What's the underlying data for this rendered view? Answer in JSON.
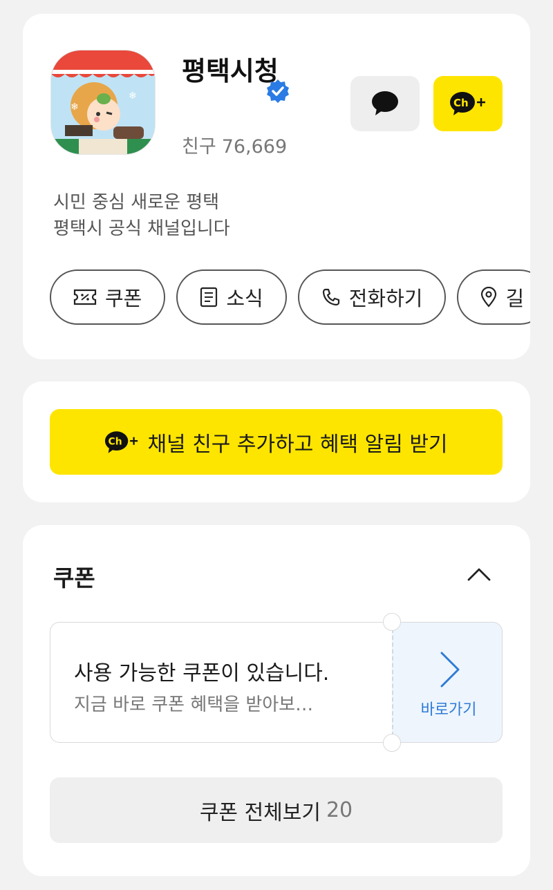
{
  "profile": {
    "name": "평택시청",
    "friends_label": "친구",
    "friends_count": "76,669",
    "description_line1": "시민 중심 새로운 평택",
    "description_line2": "평택시 공식 채널입니다",
    "verified_icon": "verified-check-icon",
    "chat_icon": "chat-bubble-icon",
    "channel_add_icon": "channel-plus-icon",
    "chips": [
      {
        "label": "쿠폰",
        "icon": "coupon-icon"
      },
      {
        "label": "소식",
        "icon": "news-icon"
      },
      {
        "label": "전화하기",
        "icon": "phone-icon"
      },
      {
        "label": "길",
        "icon": "location-pin-icon"
      }
    ]
  },
  "add_friend": {
    "label": "채널 친구 추가하고 혜택 알림 받기"
  },
  "coupon_section": {
    "title": "쿠폰",
    "ticket_title": "사용 가능한 쿠폰이 있습니다.",
    "ticket_subtitle": "지금 바로 쿠폰 혜택을 받아보…",
    "go_label": "바로가기",
    "view_all_label": "쿠폰 전체보기",
    "view_all_count": "20"
  },
  "colors": {
    "kakao_yellow": "#fee500",
    "link_blue": "#2f7bd4",
    "verified_blue": "#2a7be4"
  }
}
